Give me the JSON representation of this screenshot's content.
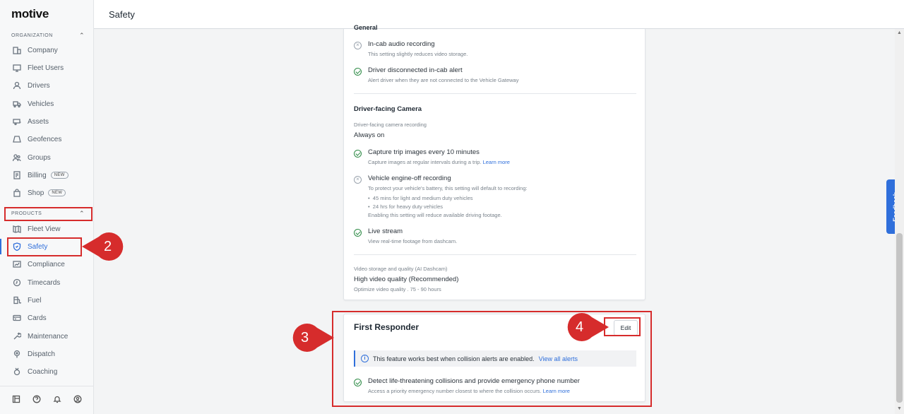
{
  "app": {
    "logo": "motive",
    "page_title": "Safety"
  },
  "sidebar": {
    "org_header": "ORGANIZATION",
    "products_header": "PRODUCTS",
    "org_items": [
      {
        "label": "Company",
        "icon": "building-icon"
      },
      {
        "label": "Fleet Users",
        "icon": "monitor-icon"
      },
      {
        "label": "Drivers",
        "icon": "person-icon"
      },
      {
        "label": "Vehicles",
        "icon": "truck-icon"
      },
      {
        "label": "Assets",
        "icon": "trailer-icon"
      },
      {
        "label": "Geofences",
        "icon": "geofence-icon"
      },
      {
        "label": "Groups",
        "icon": "groups-icon"
      },
      {
        "label": "Billing",
        "icon": "billing-icon",
        "badge": "NEW"
      },
      {
        "label": "Shop",
        "icon": "shop-icon",
        "badge": "NEW"
      }
    ],
    "product_items": [
      {
        "label": "Fleet View",
        "icon": "map-icon"
      },
      {
        "label": "Safety",
        "icon": "shield-icon",
        "active": true
      },
      {
        "label": "Compliance",
        "icon": "compliance-icon"
      },
      {
        "label": "Timecards",
        "icon": "clock-icon"
      },
      {
        "label": "Fuel",
        "icon": "fuel-icon"
      },
      {
        "label": "Cards",
        "icon": "card-icon"
      },
      {
        "label": "Maintenance",
        "icon": "wrench-icon"
      },
      {
        "label": "Dispatch",
        "icon": "dispatch-icon"
      },
      {
        "label": "Coaching",
        "icon": "coaching-icon"
      }
    ]
  },
  "settings": {
    "general_cut": "General",
    "audio": {
      "title": "In-cab audio recording",
      "desc": "This setting slightly reduces video storage.",
      "enabled": false
    },
    "disconnected": {
      "title": "Driver disconnected in-cab alert",
      "desc": "Alert driver when they are not connected to the Vehicle Gateway",
      "enabled": true
    },
    "dfc_header": "Driver-facing Camera",
    "dfc_label": "Driver-facing camera recording",
    "dfc_value": "Always on",
    "trip_images": {
      "title": "Capture trip images every 10 minutes",
      "desc": "Capture images at regular intervals during a trip.",
      "link": "Learn more",
      "enabled": true
    },
    "engine_off": {
      "title": "Vehicle engine-off recording",
      "desc": "To protect your vehicle's battery, this setting will default to recording:",
      "bullets": [
        "45 mins for light and medium duty vehicles",
        "24 hrs for heavy duty vehicles"
      ],
      "note": "Enabling this setting will reduce available driving footage.",
      "enabled": false
    },
    "live_stream": {
      "title": "Live stream",
      "desc": "View real-time footage from dashcam.",
      "enabled": true
    },
    "storage_label": "Video storage and quality (AI Dashcam)",
    "storage_value": "High video quality (Recommended)",
    "storage_desc": "Optimize video quality . 75 - 90 hours"
  },
  "first_responder": {
    "title": "First Responder",
    "edit_label": "Edit",
    "info_text": "This feature works best when collision alerts are enabled.",
    "info_link": "View all alerts",
    "detect_title": "Detect life-threatening collisions and provide emergency phone number",
    "detect_desc": "Access a priority emergency number closest to where the collision occurs.",
    "detect_link": "Learn more"
  },
  "feedback_label": "Feedback",
  "annotations": {
    "step2": "2",
    "step3": "3",
    "step4": "4"
  },
  "colors": {
    "accent": "#2f6fdb",
    "annotation": "#d62c2c",
    "success": "#2e8b46"
  }
}
